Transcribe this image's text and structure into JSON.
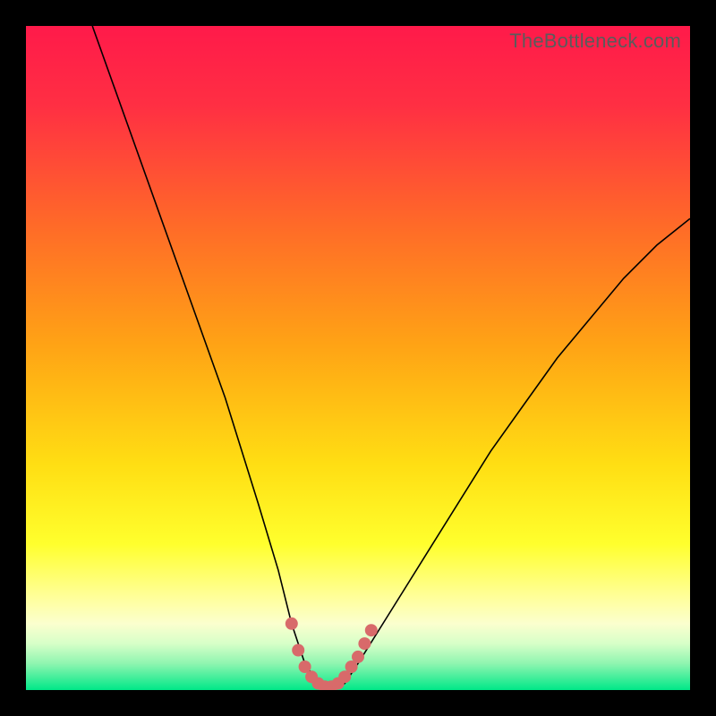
{
  "watermark": "TheBottleneck.com",
  "colors": {
    "orange": "#ffa315",
    "red_top": "#ff1a4a",
    "yellow": "#ffff2d",
    "green_bottom": "#00e888",
    "pale_yellow": "#ffff9a",
    "dot": "#d86a6a",
    "curve": "#000000"
  },
  "chart_data": {
    "type": "line",
    "title": "",
    "xlabel": "",
    "ylabel": "",
    "xlim": [
      0,
      100
    ],
    "ylim": [
      0,
      100
    ],
    "notes": "V-shaped bottleneck curve; minimum (~0%) near x≈42–47; pink dots cluster at the valley; background is a red→yellow→green vertical gradient",
    "series": [
      {
        "name": "bottleneck-curve",
        "x": [
          10,
          15,
          20,
          25,
          30,
          35,
          38,
          40,
          42,
          44,
          46,
          48,
          50,
          55,
          60,
          65,
          70,
          75,
          80,
          85,
          90,
          95,
          100
        ],
        "y": [
          100,
          86,
          72,
          58,
          44,
          28,
          18,
          10,
          4,
          1,
          0,
          1,
          4,
          12,
          20,
          28,
          36,
          43,
          50,
          56,
          62,
          67,
          71
        ]
      }
    ],
    "dots": [
      {
        "x": 40,
        "y": 10
      },
      {
        "x": 41,
        "y": 6
      },
      {
        "x": 42,
        "y": 3.5
      },
      {
        "x": 43,
        "y": 2
      },
      {
        "x": 44,
        "y": 1
      },
      {
        "x": 45,
        "y": 0.5
      },
      {
        "x": 46,
        "y": 0.5
      },
      {
        "x": 47,
        "y": 1
      },
      {
        "x": 48,
        "y": 2
      },
      {
        "x": 49,
        "y": 3.5
      },
      {
        "x": 50,
        "y": 5
      },
      {
        "x": 51,
        "y": 7
      },
      {
        "x": 52,
        "y": 9
      }
    ]
  }
}
